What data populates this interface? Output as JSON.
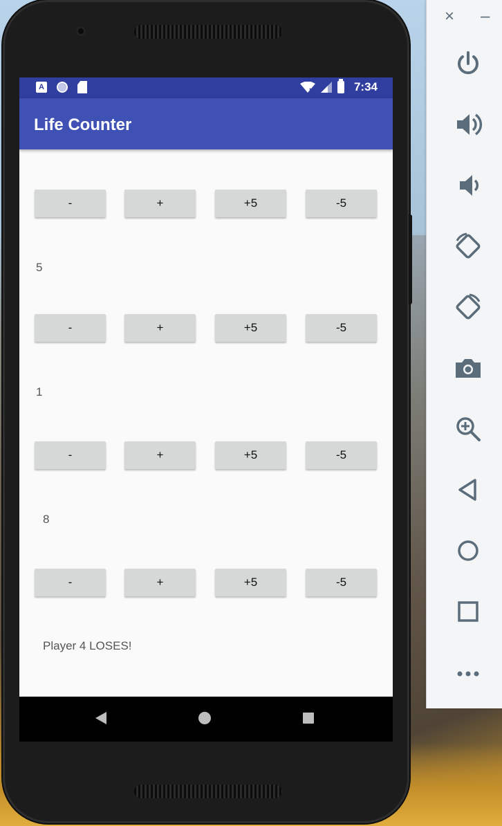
{
  "status_bar": {
    "time": "7:34",
    "notification_a_label": "A"
  },
  "app": {
    "title": "Life Counter"
  },
  "players": [
    {
      "buttons": [
        "-",
        "+",
        "+5",
        "-5"
      ],
      "life": "5"
    },
    {
      "buttons": [
        "-",
        "+",
        "+5",
        "-5"
      ],
      "life": "1"
    },
    {
      "buttons": [
        "-",
        "+",
        "+5",
        "-5"
      ],
      "life": "8"
    },
    {
      "buttons": [
        "-",
        "+",
        "+5",
        "-5"
      ],
      "life": ""
    }
  ],
  "result_message": "Player 4 LOSES!",
  "emulator_panel": {
    "close_label": "×",
    "minimize_label": "–",
    "controls": [
      "power-icon",
      "volume-up-icon",
      "volume-down-icon",
      "rotate-left-icon",
      "rotate-right-icon",
      "camera-icon",
      "zoom-icon",
      "back-icon",
      "home-icon",
      "overview-icon",
      "more-icon"
    ]
  },
  "colors": {
    "status_bar": "#303f9f",
    "app_bar": "#3f51b5",
    "button": "#d6d7d7",
    "panel_icon": "#5b6c7b"
  }
}
